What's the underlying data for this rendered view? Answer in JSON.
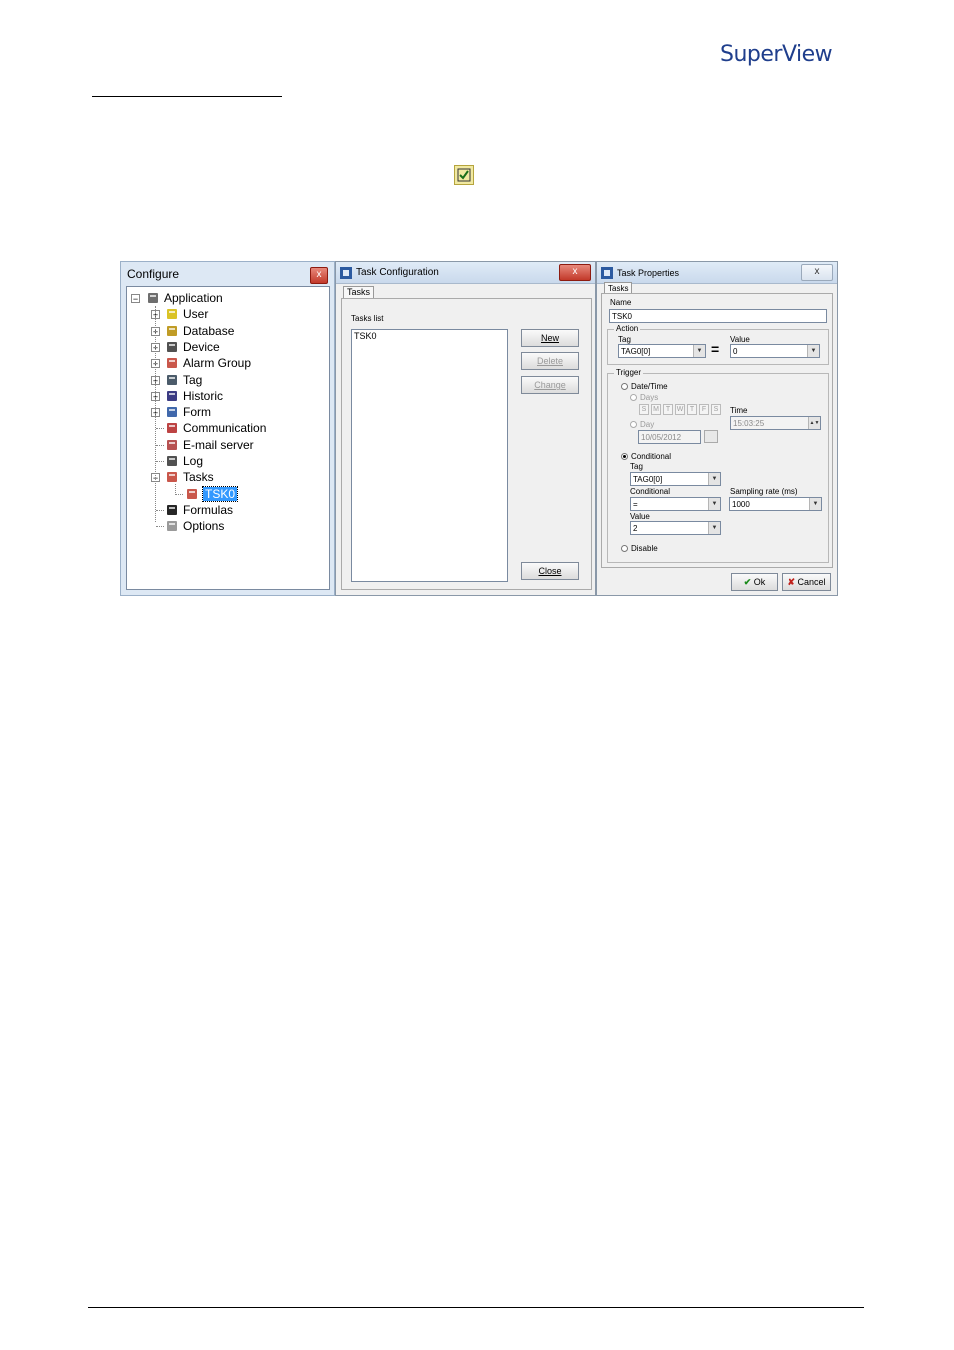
{
  "header": {
    "logo_text": "SuperView"
  },
  "configure": {
    "title": "Configure",
    "close_label": "x",
    "tree": [
      {
        "label": "Application",
        "icon": "computer-icon",
        "color": "#555555"
      },
      {
        "label": "User",
        "icon": "key-icon",
        "color": "#d4b800"
      },
      {
        "label": "Database",
        "icon": "database-icon",
        "color": "#b58b00"
      },
      {
        "label": "Device",
        "icon": "device-icon",
        "color": "#333333"
      },
      {
        "label": "Alarm Group",
        "icon": "speaker-icon",
        "color": "#c0392b"
      },
      {
        "label": "Tag",
        "icon": "tag-icon",
        "color": "#2c3e50"
      },
      {
        "label": "Historic",
        "icon": "list-icon",
        "color": "#1a1a6e"
      },
      {
        "label": "Form",
        "icon": "form-icon",
        "color": "#1f4e9c"
      },
      {
        "label": "Communication",
        "icon": "phone-icon",
        "color": "#b22222"
      },
      {
        "label": "E-mail server",
        "icon": "mail-icon",
        "color": "#a33"
      },
      {
        "label": "Log",
        "icon": "log-icon",
        "color": "#333333"
      },
      {
        "label": "Tasks",
        "icon": "tasks-icon",
        "color": "#c0392b"
      },
      {
        "label": "TSK0",
        "icon": "task-icon",
        "color": "#c0392b"
      },
      {
        "label": "Formulas",
        "icon": "formula-icon",
        "color": "#000000"
      },
      {
        "label": "Options",
        "icon": "gear-icon",
        "color": "#888888"
      }
    ]
  },
  "task_config": {
    "title": "Task Configuration",
    "close_label": "x",
    "tab": "Tasks",
    "list_label": "Tasks list",
    "list_items": [
      "TSK0"
    ],
    "buttons": {
      "new": "New",
      "delete": "Delete",
      "change": "Change",
      "close": "Close"
    }
  },
  "task_props": {
    "title": "Task Properties",
    "close_label": "x",
    "tab": "Tasks",
    "name_label": "Name",
    "name_value": "TSK0",
    "action": {
      "group_label": "Action",
      "tag_label": "Tag",
      "tag_value": "TAG0[0]",
      "equals": "=",
      "value_label": "Value",
      "value_value": "0"
    },
    "trigger": {
      "group_label": "Trigger",
      "datetime_label": "Date/Time",
      "days_label": "Days",
      "days": [
        "S",
        "M",
        "T",
        "W",
        "T",
        "F",
        "S"
      ],
      "day_label": "Day",
      "day_value": "10/05/2012",
      "time_label": "Time",
      "time_value": "15:03:25",
      "conditional_radio": "Conditional",
      "tag_label": "Tag",
      "tag_value": "TAG0[0]",
      "conditional_label": "Conditional",
      "conditional_value": "=",
      "sampling_label": "Sampling rate (ms)",
      "sampling_value": "1000",
      "value_label": "Value",
      "value_value": "2",
      "disable_label": "Disable"
    },
    "ok_label": "Ok",
    "cancel_label": "Cancel"
  }
}
